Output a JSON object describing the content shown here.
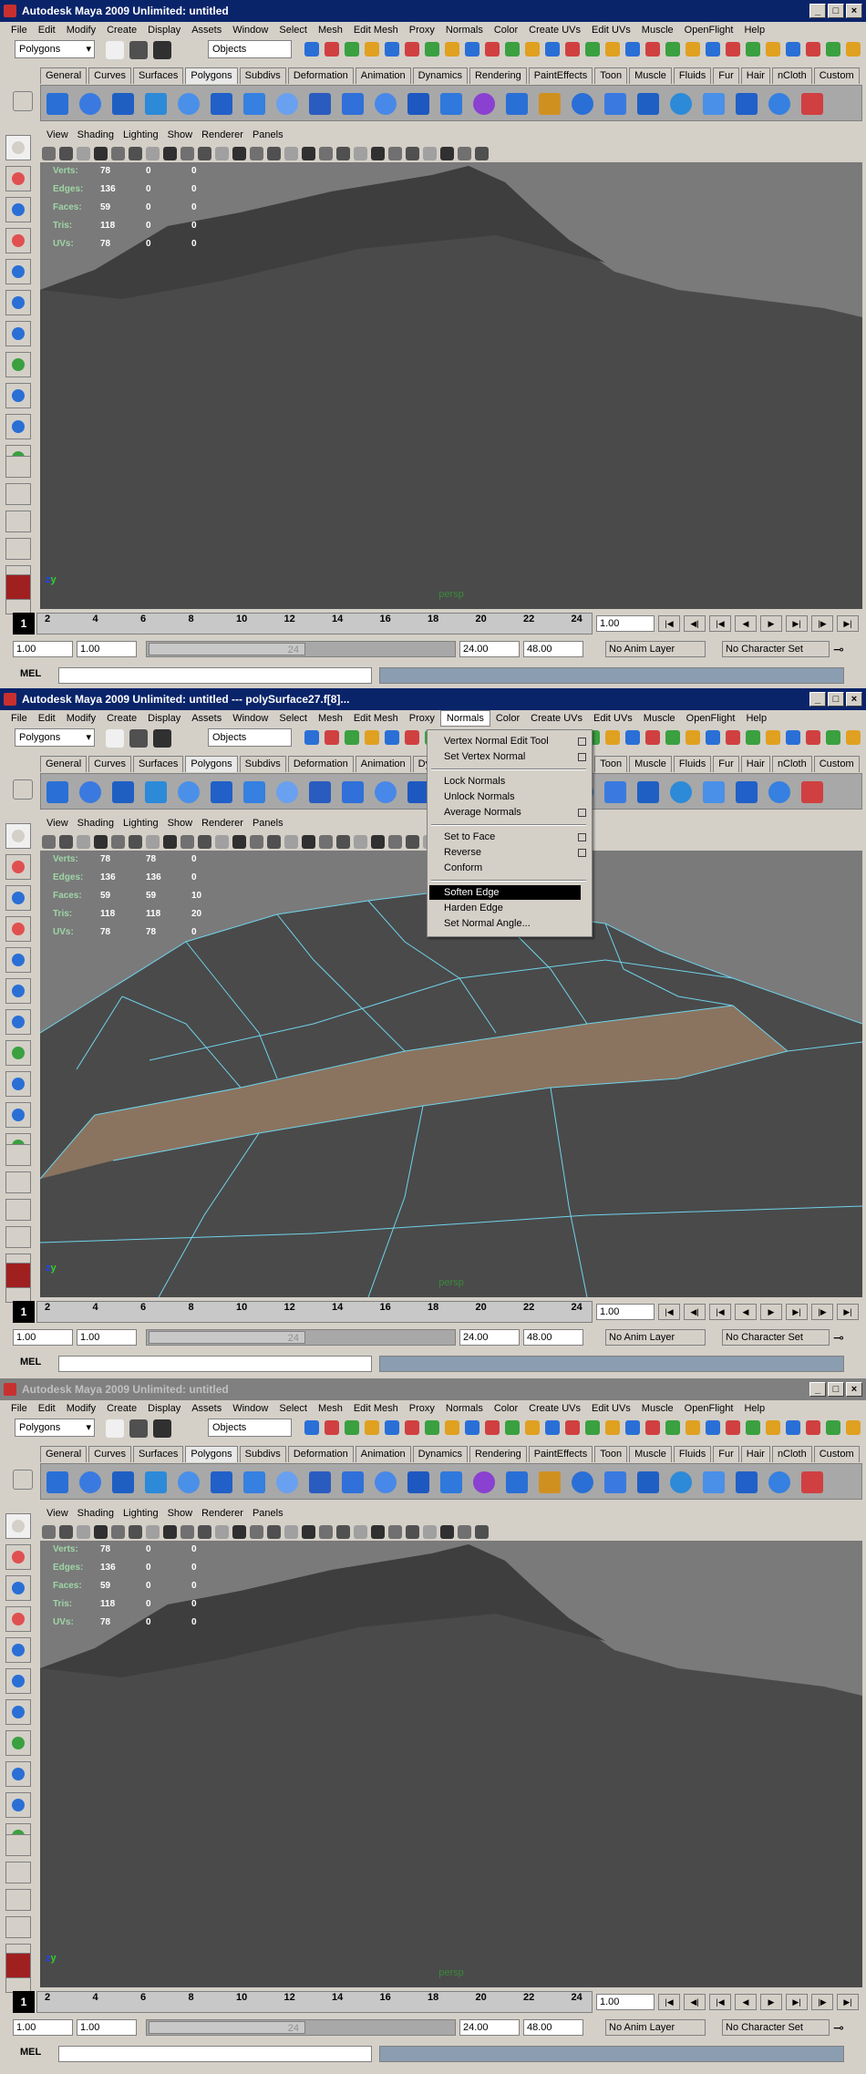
{
  "windows": [
    {
      "title": "Autodesk Maya 2009 Unlimited: untitled",
      "active": true,
      "hud": [
        {
          "label": "Verts:",
          "values": [
            "78",
            "0",
            "0"
          ]
        },
        {
          "label": "Edges:",
          "values": [
            "136",
            "0",
            "0"
          ]
        },
        {
          "label": "Faces:",
          "values": [
            "59",
            "0",
            "0"
          ]
        },
        {
          "label": "Tris:",
          "values": [
            "118",
            "0",
            "0"
          ]
        },
        {
          "label": "UVs:",
          "values": [
            "78",
            "0",
            "0"
          ]
        }
      ]
    },
    {
      "title": "Autodesk Maya 2009 Unlimited: untitled  ---  polySurface27.f[8]...",
      "active": true,
      "hud": [
        {
          "label": "Verts:",
          "values": [
            "78",
            "78",
            "0"
          ]
        },
        {
          "label": "Edges:",
          "values": [
            "136",
            "136",
            "0"
          ]
        },
        {
          "label": "Faces:",
          "values": [
            "59",
            "59",
            "10"
          ]
        },
        {
          "label": "Tris:",
          "values": [
            "118",
            "118",
            "20"
          ]
        },
        {
          "label": "UVs:",
          "values": [
            "78",
            "78",
            "0"
          ]
        }
      ]
    },
    {
      "title": "Autodesk Maya 2009 Unlimited: untitled",
      "active": false,
      "hud": [
        {
          "label": "Verts:",
          "values": [
            "78",
            "0",
            "0"
          ]
        },
        {
          "label": "Edges:",
          "values": [
            "136",
            "0",
            "0"
          ]
        },
        {
          "label": "Faces:",
          "values": [
            "59",
            "0",
            "0"
          ]
        },
        {
          "label": "Tris:",
          "values": [
            "118",
            "0",
            "0"
          ]
        },
        {
          "label": "UVs:",
          "values": [
            "78",
            "0",
            "0"
          ]
        }
      ]
    }
  ],
  "menubar": [
    "File",
    "Edit",
    "Modify",
    "Create",
    "Display",
    "Assets",
    "Window",
    "Select",
    "Mesh",
    "Edit Mesh",
    "Proxy",
    "Normals",
    "Color",
    "Create UVs",
    "Edit UVs",
    "Muscle",
    "OpenFlight",
    "Help"
  ],
  "open_menu": "Normals",
  "mode_select": "Polygons",
  "objects_field": "Objects",
  "shelf_tabs": [
    "General",
    "Curves",
    "Surfaces",
    "Polygons",
    "Subdivs",
    "Deformation",
    "Animation",
    "Dynamics",
    "Rendering",
    "PaintEffects",
    "Toon",
    "Muscle",
    "Fluids",
    "Fur",
    "Hair",
    "nCloth",
    "Custom"
  ],
  "active_shelf_tab": "Polygons",
  "panel_menu": [
    "View",
    "Shading",
    "Lighting",
    "Show",
    "Renderer",
    "Panels"
  ],
  "viewport_label": "persp",
  "timeline": {
    "current_frame": "1",
    "ticks": [
      "2",
      "4",
      "6",
      "8",
      "10",
      "12",
      "14",
      "16",
      "18",
      "20",
      "22",
      "24"
    ],
    "current_time": "1.00"
  },
  "range": {
    "start": "1.00",
    "start_range": "1.00",
    "end_range_thumb": "24",
    "end": "24.00",
    "max": "48.00",
    "anim_layer": "No Anim Layer",
    "char_set": "No Character Set"
  },
  "command_line": {
    "label": "MEL"
  },
  "normals_menu": [
    {
      "label": "Vertex Normal Edit Tool",
      "option": true
    },
    {
      "label": "Set Vertex Normal",
      "option": true
    },
    {
      "separator": true
    },
    {
      "label": "Lock Normals",
      "option": false
    },
    {
      "label": "Unlock Normals",
      "option": false
    },
    {
      "label": "Average Normals",
      "option": true
    },
    {
      "separator": true
    },
    {
      "label": "Set to Face",
      "option": true
    },
    {
      "label": "Reverse",
      "option": true
    },
    {
      "label": "Conform",
      "option": false
    },
    {
      "separator": true
    },
    {
      "label": "Soften Edge",
      "option": false,
      "highlighted": true
    },
    {
      "label": "Harden Edge",
      "option": false
    },
    {
      "label": "Set Normal Angle...",
      "option": false
    }
  ],
  "colors": {
    "title_active": "#0a246a",
    "title_inactive": "#808080",
    "viewport_bg": "#7a7a7a",
    "mesh_dark": "#4a4a4a",
    "selected_face": "#8a7460",
    "wire": "#6fd3ea",
    "hud_label": "#9ed6a6"
  }
}
